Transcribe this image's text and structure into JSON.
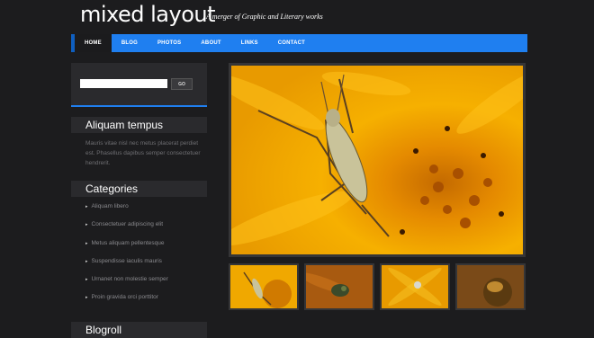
{
  "header": {
    "title": "mixed layout",
    "tagline": "A merger of Graphic and Literary works"
  },
  "nav": {
    "items": [
      {
        "label": "HOME",
        "active": true
      },
      {
        "label": "BLOG",
        "active": false
      },
      {
        "label": "PHOTOS",
        "active": false
      },
      {
        "label": "ABOUT",
        "active": false
      },
      {
        "label": "LINKS",
        "active": false
      },
      {
        "label": "CONTACT",
        "active": false
      }
    ]
  },
  "search": {
    "button_label": "GO",
    "placeholder": ""
  },
  "widgets": {
    "aliquam": {
      "title": "Aliquam tempus",
      "text": "Mauris vitae nisl nec metus placerat perdiet est. Phasellus dapibus semper consectetuer hendrerit."
    },
    "categories": {
      "title": "Categories",
      "items": [
        "Aliquam libero",
        "Consectetuer adipiscing elit",
        "Metus aliquam pellentesque",
        "Suspendisse iaculis mauris",
        "Urnanet non molestie semper",
        "Proin gravida orci porttitor"
      ]
    },
    "blogroll": {
      "title": "Blogroll"
    }
  },
  "colors": {
    "accent": "#1f7ff0",
    "background": "#1c1c1e",
    "panel": "#2a2a2d"
  },
  "images": {
    "main": "grasshopper-on-yellow-flower",
    "thumbs": [
      "grasshopper-on-yellow-flower",
      "bee-on-orange-flower",
      "spider-on-yellow-flower",
      "bee-on-brown-flower"
    ]
  }
}
